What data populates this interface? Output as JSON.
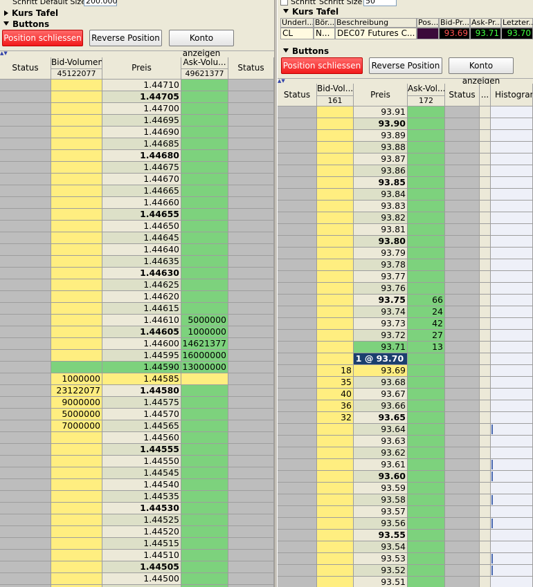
{
  "left": {
    "top_setting": {
      "label": "Schritt Default Size",
      "value": "200.000"
    },
    "sections": {
      "kurs_tafel": "Kurs Tafel",
      "buttons": "Buttons"
    },
    "buttons": {
      "close": "Position schliessen",
      "reverse": "Reverse Position",
      "account": "Konto anzeigen"
    },
    "columns": {
      "status": "Status",
      "bid": "Bid-Volumen",
      "bid_total": "45122077",
      "price": "Preis",
      "ask": "Ask-Volu...",
      "ask_total": "49621377",
      "status2": "Status"
    },
    "rows": [
      {
        "p": "1.44710",
        "b": "",
        "a": "",
        "bold": false,
        "hl": ""
      },
      {
        "p": "1.44705",
        "b": "",
        "a": "",
        "bold": true,
        "hl": ""
      },
      {
        "p": "1.44700",
        "b": "",
        "a": "",
        "bold": false,
        "hl": ""
      },
      {
        "p": "1.44695",
        "b": "",
        "a": "",
        "bold": false,
        "hl": ""
      },
      {
        "p": "1.44690",
        "b": "",
        "a": "",
        "bold": false,
        "hl": ""
      },
      {
        "p": "1.44685",
        "b": "",
        "a": "",
        "bold": false,
        "hl": ""
      },
      {
        "p": "1.44680",
        "b": "",
        "a": "",
        "bold": true,
        "hl": ""
      },
      {
        "p": "1.44675",
        "b": "",
        "a": "",
        "bold": false,
        "hl": ""
      },
      {
        "p": "1.44670",
        "b": "",
        "a": "",
        "bold": false,
        "hl": ""
      },
      {
        "p": "1.44665",
        "b": "",
        "a": "",
        "bold": false,
        "hl": ""
      },
      {
        "p": "1.44660",
        "b": "",
        "a": "",
        "bold": false,
        "hl": ""
      },
      {
        "p": "1.44655",
        "b": "",
        "a": "",
        "bold": true,
        "hl": ""
      },
      {
        "p": "1.44650",
        "b": "",
        "a": "",
        "bold": false,
        "hl": ""
      },
      {
        "p": "1.44645",
        "b": "",
        "a": "",
        "bold": false,
        "hl": ""
      },
      {
        "p": "1.44640",
        "b": "",
        "a": "",
        "bold": false,
        "hl": ""
      },
      {
        "p": "1.44635",
        "b": "",
        "a": "",
        "bold": false,
        "hl": ""
      },
      {
        "p": "1.44630",
        "b": "",
        "a": "",
        "bold": true,
        "hl": ""
      },
      {
        "p": "1.44625",
        "b": "",
        "a": "",
        "bold": false,
        "hl": ""
      },
      {
        "p": "1.44620",
        "b": "",
        "a": "",
        "bold": false,
        "hl": ""
      },
      {
        "p": "1.44615",
        "b": "",
        "a": "",
        "bold": false,
        "hl": ""
      },
      {
        "p": "1.44610",
        "b": "",
        "a": "5000000",
        "bold": false,
        "hl": ""
      },
      {
        "p": "1.44605",
        "b": "",
        "a": "1000000",
        "bold": true,
        "hl": ""
      },
      {
        "p": "1.44600",
        "b": "",
        "a": "14621377",
        "bold": false,
        "hl": ""
      },
      {
        "p": "1.44595",
        "b": "",
        "a": "16000000",
        "bold": false,
        "hl": ""
      },
      {
        "p": "1.44590",
        "b": "",
        "a": "13000000",
        "bold": false,
        "hl": "ask"
      },
      {
        "p": "1.44585",
        "b": "1000000",
        "a": "",
        "bold": false,
        "hl": "bid"
      },
      {
        "p": "1.44580",
        "b": "23122077",
        "a": "",
        "bold": true,
        "hl": ""
      },
      {
        "p": "1.44575",
        "b": "9000000",
        "a": "",
        "bold": false,
        "hl": ""
      },
      {
        "p": "1.44570",
        "b": "5000000",
        "a": "",
        "bold": false,
        "hl": ""
      },
      {
        "p": "1.44565",
        "b": "7000000",
        "a": "",
        "bold": false,
        "hl": ""
      },
      {
        "p": "1.44560",
        "b": "",
        "a": "",
        "bold": false,
        "hl": ""
      },
      {
        "p": "1.44555",
        "b": "",
        "a": "",
        "bold": true,
        "hl": ""
      },
      {
        "p": "1.44550",
        "b": "",
        "a": "",
        "bold": false,
        "hl": ""
      },
      {
        "p": "1.44545",
        "b": "",
        "a": "",
        "bold": false,
        "hl": ""
      },
      {
        "p": "1.44540",
        "b": "",
        "a": "",
        "bold": false,
        "hl": ""
      },
      {
        "p": "1.44535",
        "b": "",
        "a": "",
        "bold": false,
        "hl": ""
      },
      {
        "p": "1.44530",
        "b": "",
        "a": "",
        "bold": true,
        "hl": ""
      },
      {
        "p": "1.44525",
        "b": "",
        "a": "",
        "bold": false,
        "hl": ""
      },
      {
        "p": "1.44520",
        "b": "",
        "a": "",
        "bold": false,
        "hl": ""
      },
      {
        "p": "1.44515",
        "b": "",
        "a": "",
        "bold": false,
        "hl": ""
      },
      {
        "p": "1.44510",
        "b": "",
        "a": "",
        "bold": false,
        "hl": ""
      },
      {
        "p": "1.44505",
        "b": "",
        "a": "",
        "bold": true,
        "hl": ""
      },
      {
        "p": "1.44500",
        "b": "",
        "a": "",
        "bold": false,
        "hl": ""
      },
      {
        "p": "",
        "b": "",
        "a": "",
        "bold": false,
        "hl": ""
      }
    ]
  },
  "right": {
    "top_setting": {
      "label1": "Schritt",
      "label2": "Schritt Size",
      "value": "50"
    },
    "sections": {
      "kurs_tafel": "Kurs Tafel",
      "buttons": "Buttons"
    },
    "kurs_tafel": {
      "headers": [
        "Underl...",
        "Bör...",
        "Beschreibung",
        "Pos...",
        "Bid-Pr...",
        "Ask-Pr...",
        "Letzter..."
      ],
      "values": [
        "CL",
        "N...",
        "DEC07 Futures C...",
        "",
        "93.69",
        "93.71",
        "93.70"
      ]
    },
    "buttons": {
      "close": "Position schliessen",
      "reverse": "Reverse Position",
      "account": "Konto anzeigen"
    },
    "columns": {
      "status": "Status",
      "bid": "Bid-Vol...",
      "bid_total": "161",
      "price": "Preis",
      "ask": "Ask-Vol...",
      "ask_total": "172",
      "status2": "Status",
      "dots": "...",
      "hist": "Histogram"
    },
    "rows": [
      {
        "p": "93.91",
        "b": "",
        "a": "",
        "bold": false,
        "hl": "",
        "h": 0
      },
      {
        "p": "93.90",
        "b": "",
        "a": "",
        "bold": true,
        "hl": "",
        "h": 0
      },
      {
        "p": "93.89",
        "b": "",
        "a": "",
        "bold": false,
        "hl": "",
        "h": 0
      },
      {
        "p": "93.88",
        "b": "",
        "a": "",
        "bold": false,
        "hl": "",
        "h": 0
      },
      {
        "p": "93.87",
        "b": "",
        "a": "",
        "bold": false,
        "hl": "",
        "h": 0
      },
      {
        "p": "93.86",
        "b": "",
        "a": "",
        "bold": false,
        "hl": "",
        "h": 0
      },
      {
        "p": "93.85",
        "b": "",
        "a": "",
        "bold": true,
        "hl": "",
        "h": 0
      },
      {
        "p": "93.84",
        "b": "",
        "a": "",
        "bold": false,
        "hl": "",
        "h": 0
      },
      {
        "p": "93.83",
        "b": "",
        "a": "",
        "bold": false,
        "hl": "",
        "h": 0
      },
      {
        "p": "93.82",
        "b": "",
        "a": "",
        "bold": false,
        "hl": "",
        "h": 0
      },
      {
        "p": "93.81",
        "b": "",
        "a": "",
        "bold": false,
        "hl": "",
        "h": 0
      },
      {
        "p": "93.80",
        "b": "",
        "a": "",
        "bold": true,
        "hl": "",
        "h": 0
      },
      {
        "p": "93.79",
        "b": "",
        "a": "",
        "bold": false,
        "hl": "",
        "h": 0
      },
      {
        "p": "93.78",
        "b": "",
        "a": "",
        "bold": false,
        "hl": "",
        "h": 0
      },
      {
        "p": "93.77",
        "b": "",
        "a": "",
        "bold": false,
        "hl": "",
        "h": 0
      },
      {
        "p": "93.76",
        "b": "",
        "a": "",
        "bold": false,
        "hl": "",
        "h": 0
      },
      {
        "p": "93.75",
        "b": "",
        "a": "66",
        "bold": true,
        "hl": "",
        "h": 0
      },
      {
        "p": "93.74",
        "b": "",
        "a": "24",
        "bold": false,
        "hl": "",
        "h": 0
      },
      {
        "p": "93.73",
        "b": "",
        "a": "42",
        "bold": false,
        "hl": "",
        "h": 0
      },
      {
        "p": "93.72",
        "b": "",
        "a": "27",
        "bold": false,
        "hl": "",
        "h": 0
      },
      {
        "p": "93.71",
        "b": "",
        "a": "13",
        "bold": false,
        "hl": "ask",
        "h": 0
      },
      {
        "p": "1 @ 93.70",
        "b": "",
        "a": "",
        "bold": true,
        "hl": "cur",
        "h": 0
      },
      {
        "p": "93.69",
        "b": "18",
        "a": "",
        "bold": false,
        "hl": "bid",
        "h": 0
      },
      {
        "p": "93.68",
        "b": "35",
        "a": "",
        "bold": false,
        "hl": "",
        "h": 0
      },
      {
        "p": "93.67",
        "b": "40",
        "a": "",
        "bold": false,
        "hl": "",
        "h": 0
      },
      {
        "p": "93.66",
        "b": "36",
        "a": "",
        "bold": false,
        "hl": "",
        "h": 0
      },
      {
        "p": "93.65",
        "b": "32",
        "a": "",
        "bold": true,
        "hl": "",
        "h": 0
      },
      {
        "p": "93.64",
        "b": "",
        "a": "",
        "bold": false,
        "hl": "",
        "h": 1
      },
      {
        "p": "93.63",
        "b": "",
        "a": "",
        "bold": false,
        "hl": "",
        "h": 0
      },
      {
        "p": "93.62",
        "b": "",
        "a": "",
        "bold": false,
        "hl": "",
        "h": 0
      },
      {
        "p": "93.61",
        "b": "",
        "a": "",
        "bold": false,
        "hl": "",
        "h": 1
      },
      {
        "p": "93.60",
        "b": "",
        "a": "",
        "bold": true,
        "hl": "",
        "h": 1
      },
      {
        "p": "93.59",
        "b": "",
        "a": "",
        "bold": false,
        "hl": "",
        "h": 0
      },
      {
        "p": "93.58",
        "b": "",
        "a": "",
        "bold": false,
        "hl": "",
        "h": 1
      },
      {
        "p": "93.57",
        "b": "",
        "a": "",
        "bold": false,
        "hl": "",
        "h": 0
      },
      {
        "p": "93.56",
        "b": "",
        "a": "",
        "bold": false,
        "hl": "",
        "h": 1
      },
      {
        "p": "93.55",
        "b": "",
        "a": "",
        "bold": true,
        "hl": "",
        "h": 0
      },
      {
        "p": "93.54",
        "b": "",
        "a": "",
        "bold": false,
        "hl": "",
        "h": 0
      },
      {
        "p": "93.53",
        "b": "",
        "a": "",
        "bold": false,
        "hl": "",
        "h": 1
      },
      {
        "p": "93.52",
        "b": "",
        "a": "",
        "bold": false,
        "hl": "",
        "h": 1
      },
      {
        "p": "93.51",
        "b": "",
        "a": "",
        "bold": false,
        "hl": "",
        "h": 0
      }
    ]
  }
}
